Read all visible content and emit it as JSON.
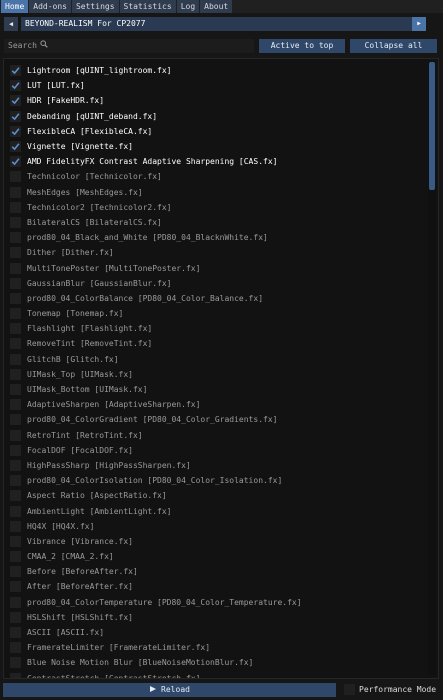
{
  "tabs": [
    "Home",
    "Add-ons",
    "Settings",
    "Statistics",
    "Log",
    "About"
  ],
  "preset": {
    "prev_icon": "chevron-left-icon",
    "next_icon": "chevron-right-icon",
    "name": "BEYOND-REALISM For CP2077"
  },
  "toolbar": {
    "search_placeholder": "Search",
    "active_to_top": "Active to top",
    "collapse_all": "Collapse all"
  },
  "effects": [
    {
      "label": "Lightroom [qUINT_lightroom.fx]",
      "enabled": true
    },
    {
      "label": "LUT [LUT.fx]",
      "enabled": true
    },
    {
      "label": "HDR [FakeHDR.fx]",
      "enabled": true
    },
    {
      "label": "Debanding [qUINT_deband.fx]",
      "enabled": true
    },
    {
      "label": "FlexibleCA [FlexibleCA.fx]",
      "enabled": true
    },
    {
      "label": "Vignette [Vignette.fx]",
      "enabled": true
    },
    {
      "label": "AMD FidelityFX Contrast Adaptive Sharpening [CAS.fx]",
      "enabled": true
    },
    {
      "label": "Technicolor [Technicolor.fx]",
      "enabled": false
    },
    {
      "label": "MeshEdges [MeshEdges.fx]",
      "enabled": false
    },
    {
      "label": "Technicolor2 [Technicolor2.fx]",
      "enabled": false
    },
    {
      "label": "BilateralCS [BilateralCS.fx]",
      "enabled": false
    },
    {
      "label": "prod80_04_Black_and_White [PD80_04_BlacknWhite.fx]",
      "enabled": false
    },
    {
      "label": "Dither [Dither.fx]",
      "enabled": false
    },
    {
      "label": "MultiTonePoster [MultiTonePoster.fx]",
      "enabled": false
    },
    {
      "label": "GaussianBlur [GaussianBlur.fx]",
      "enabled": false
    },
    {
      "label": "prod80_04_ColorBalance [PD80_04_Color_Balance.fx]",
      "enabled": false
    },
    {
      "label": "Tonemap [Tonemap.fx]",
      "enabled": false
    },
    {
      "label": "Flashlight [Flashlight.fx]",
      "enabled": false
    },
    {
      "label": "RemoveTint [RemoveTint.fx]",
      "enabled": false
    },
    {
      "label": "GlitchB [Glitch.fx]",
      "enabled": false
    },
    {
      "label": "UIMask_Top [UIMask.fx]",
      "enabled": false
    },
    {
      "label": "UIMask_Bottom [UIMask.fx]",
      "enabled": false
    },
    {
      "label": "AdaptiveSharpen [AdaptiveSharpen.fx]",
      "enabled": false
    },
    {
      "label": "prod80_04_ColorGradient [PD80_04_Color_Gradients.fx]",
      "enabled": false
    },
    {
      "label": "RetroTint [RetroTint.fx]",
      "enabled": false
    },
    {
      "label": "FocalDOF [FocalDOF.fx]",
      "enabled": false
    },
    {
      "label": "HighPassSharp [HighPassSharpen.fx]",
      "enabled": false
    },
    {
      "label": "prod80_04_ColorIsolation [PD80_04_Color_Isolation.fx]",
      "enabled": false
    },
    {
      "label": "Aspect Ratio [AspectRatio.fx]",
      "enabled": false
    },
    {
      "label": "AmbientLight [AmbientLight.fx]",
      "enabled": false
    },
    {
      "label": "HQ4X [HQ4X.fx]",
      "enabled": false
    },
    {
      "label": "Vibrance [Vibrance.fx]",
      "enabled": false
    },
    {
      "label": "CMAA_2 [CMAA_2.fx]",
      "enabled": false
    },
    {
      "label": "Before [BeforeAfter.fx]",
      "enabled": false
    },
    {
      "label": "After [BeforeAfter.fx]",
      "enabled": false
    },
    {
      "label": "prod80_04_ColorTemperature [PD80_04_Color_Temperature.fx]",
      "enabled": false
    },
    {
      "label": "HSLShift [HSLShift.fx]",
      "enabled": false
    },
    {
      "label": "ASCII [ASCII.fx]",
      "enabled": false
    },
    {
      "label": "FramerateLimiter [FramerateLimiter.fx]",
      "enabled": false
    },
    {
      "label": "Blue Noise Motion Blur [BlueNoiseMotionBlur.fx]",
      "enabled": false
    },
    {
      "label": "ContrastStretch [ContrastStretch.fx]",
      "enabled": false
    }
  ],
  "bottom": {
    "reload_label": "Reload",
    "performance_mode_label": "Performance Mode",
    "performance_mode": true
  },
  "colors": {
    "accent": "#4a73a8",
    "check": "#5b8fd0",
    "button": "#2f4869"
  }
}
